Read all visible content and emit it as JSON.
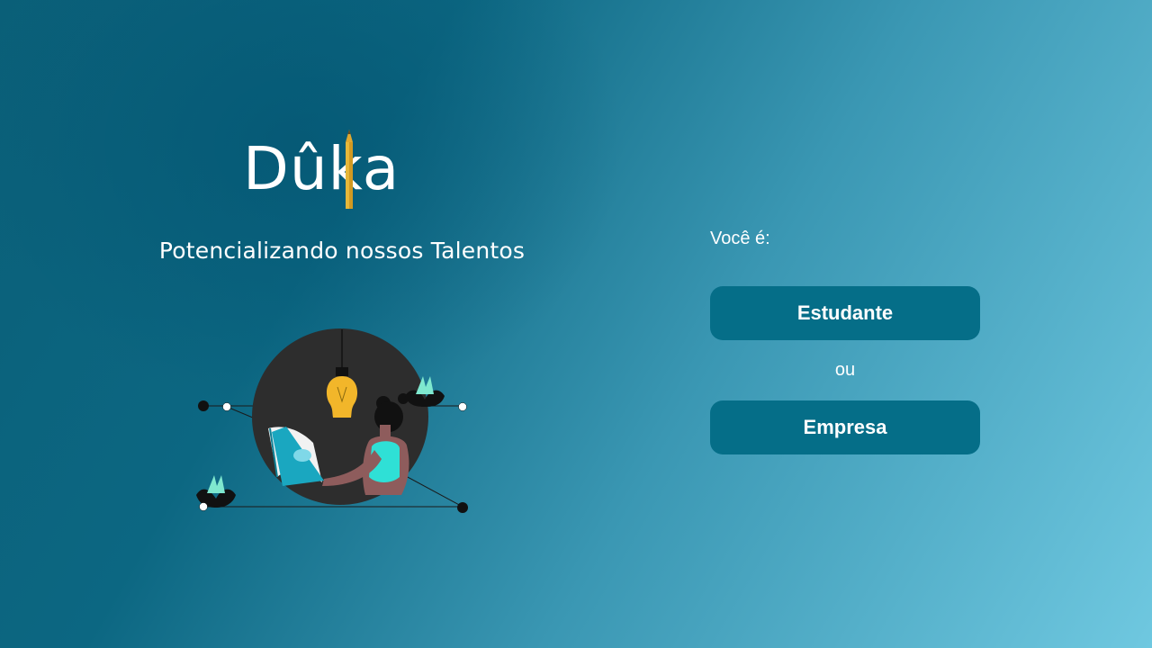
{
  "brand": {
    "logo_text": "Dûka",
    "tagline": "Potencializando nossos Talentos"
  },
  "selection": {
    "question": "Você é:",
    "student_label": "Estudante",
    "separator": "ou",
    "company_label": "Empresa"
  },
  "colors": {
    "button_bg": "#056e88",
    "pencil": "#e6b83a",
    "bulb": "#f2b62a",
    "leaf_mint": "#7fe8cf",
    "book": "#1aa7c0",
    "circle": "#2d2d2d"
  }
}
